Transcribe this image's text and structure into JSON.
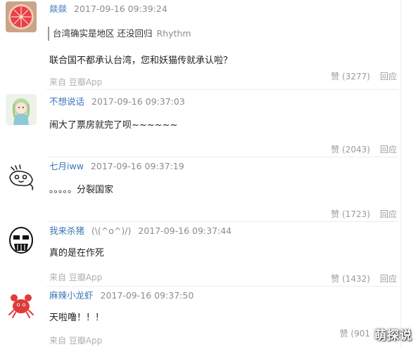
{
  "comments": [
    {
      "username": "燚燚",
      "timestamp": "2017-09-16 09:39:24",
      "quote": {
        "text": "台湾确实是地区 还没回归",
        "author": "Rhythm"
      },
      "content": "联合国不都承认台湾，您和妖猫传就承认啦？",
      "source": "来自 豆瓣App",
      "like": "赞 (3277)",
      "reply": "回应",
      "avatar_icon": "grapefruit-avatar"
    },
    {
      "username": "不想说话",
      "timestamp": "2017-09-16 09:37:03",
      "content": "闹大了票房就完了呗~~~~~~",
      "like": "赞 (2043)",
      "reply": "回应",
      "avatar_icon": "cartoon-girl-avatar"
    },
    {
      "username": "七月iww",
      "timestamp": "2017-09-16 09:37:19",
      "content": "。。。。。分裂国家",
      "like": "赞 (1723)",
      "reply": "回应",
      "avatar_icon": "sketch-creature-avatar"
    },
    {
      "username": "我来杀猪",
      "username_suffix": "(\\(^o^)/)",
      "timestamp": "2017-09-16 09:37:44",
      "content": "真的是在作死",
      "source": "来自 豆瓣App",
      "like": "赞 (1432)",
      "reply": "回应",
      "avatar_icon": "rage-face-avatar"
    },
    {
      "username": "麻辣小龙虾",
      "timestamp": "2017-09-16 09:37:50",
      "content": "天啦噜！！！",
      "source": "来自 豆瓣App",
      "like": "赞 (901",
      "avatar_icon": "red-crab-avatar"
    }
  ],
  "watermark": "萌探说"
}
